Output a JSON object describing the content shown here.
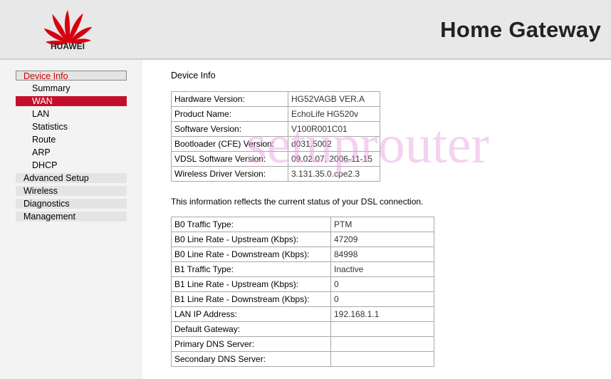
{
  "header": {
    "brand": "HUAWEI",
    "title": "Home Gateway",
    "logo_color": "#d7000f"
  },
  "sidebar": {
    "items": [
      {
        "label": "Device Info",
        "level": "top",
        "state": "selected"
      },
      {
        "label": "Summary",
        "level": "sub"
      },
      {
        "label": "WAN",
        "level": "sub",
        "state": "selected"
      },
      {
        "label": "LAN",
        "level": "sub"
      },
      {
        "label": "Statistics",
        "level": "sub"
      },
      {
        "label": "Route",
        "level": "sub"
      },
      {
        "label": "ARP",
        "level": "sub"
      },
      {
        "label": "DHCP",
        "level": "sub"
      },
      {
        "label": "Advanced Setup",
        "level": "top"
      },
      {
        "label": "Wireless",
        "level": "top"
      },
      {
        "label": "Diagnostics",
        "level": "top"
      },
      {
        "label": "Management",
        "level": "top"
      }
    ],
    "accent_color": "#c40f2b"
  },
  "main": {
    "title": "Device Info",
    "device_table": [
      {
        "label": "Hardware Version:",
        "value": "HG52VAGB VER.A"
      },
      {
        "label": "Product Name:",
        "value": "EchoLife HG520v"
      },
      {
        "label": "Software Version:",
        "value": "V100R001C01"
      },
      {
        "label": "Bootloader (CFE) Version:",
        "value": "d031.5002"
      },
      {
        "label": "VDSL Software Version:",
        "value": "09.02.07, 2006-11-15"
      },
      {
        "label": "Wireless Driver Version:",
        "value": "3.131.35.0.cpe2.3"
      }
    ],
    "info_text": "This information reflects the current status of your DSL connection.",
    "dsl_table": [
      {
        "label": "B0 Traffic Type:",
        "value": "PTM"
      },
      {
        "label": "B0 Line Rate - Upstream (Kbps):",
        "value": "47209"
      },
      {
        "label": "B0 Line Rate - Downstream (Kbps):",
        "value": "84998"
      },
      {
        "label": "B1 Traffic Type:",
        "value": "Inactive"
      },
      {
        "label": "B1 Line Rate - Upstream (Kbps):",
        "value": "0"
      },
      {
        "label": "B1 Line Rate - Downstream (Kbps):",
        "value": "0"
      },
      {
        "label": "LAN IP Address:",
        "value": "192.168.1.1"
      },
      {
        "label": "Default Gateway:",
        "value": ""
      },
      {
        "label": "Primary DNS Server:",
        "value": ""
      },
      {
        "label": "Secondary DNS Server:",
        "value": ""
      }
    ]
  },
  "watermark": {
    "text": "setuprouter",
    "color": "#e89ce0"
  }
}
